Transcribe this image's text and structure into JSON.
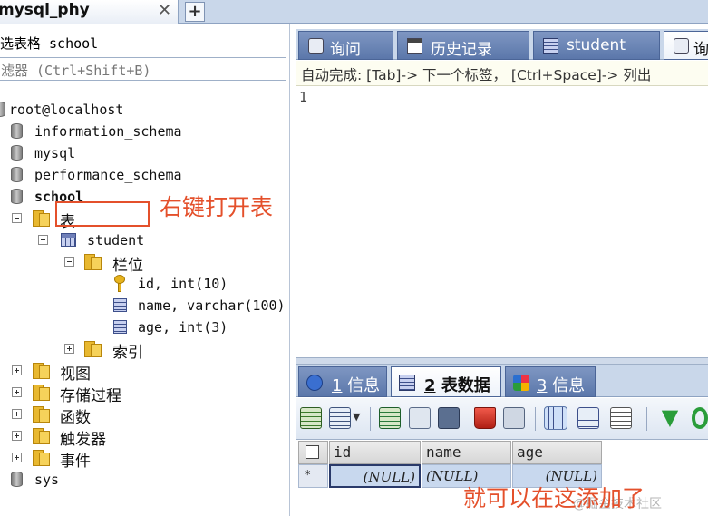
{
  "connection_tab": {
    "label": "mysql_phy",
    "close_glyph": "✕",
    "new_tab_glyph": "+"
  },
  "object_browser": {
    "db_selector": "选表格 school",
    "filter_placeholder": "滤器 (Ctrl+Shift+B)",
    "tree": {
      "root": "root@localhost",
      "databases": [
        "information_schema",
        "mysql",
        "performance_schema",
        "school"
      ],
      "school_children": {
        "tables_folder": "表",
        "table": "student",
        "columns_folder": "栏位",
        "columns": [
          "id, int(10)",
          "name, varchar(100)",
          "age, int(3)"
        ],
        "indexes_folder": "索引",
        "other_folders": [
          "视图",
          "存储过程",
          "函数",
          "触发器",
          "事件"
        ]
      },
      "last_db": "sys"
    }
  },
  "annotations": {
    "open_table": "右键打开表",
    "add_here": "就可以在这添加了"
  },
  "query_tabs": {
    "items": [
      {
        "label": "询问",
        "icon": "query-icon"
      },
      {
        "label": "历史记录",
        "icon": "history-icon"
      },
      {
        "label": "student",
        "icon": "table-icon"
      },
      {
        "label": "询",
        "icon": "query-icon"
      }
    ],
    "autocomplete_hint": "自动完成:  [Tab]-> 下一个标签，  [Ctrl+Space]-> 列出",
    "line_number": "1"
  },
  "result_tabs": {
    "items": [
      {
        "num": "1",
        "label": "信息",
        "icon": "info-icon"
      },
      {
        "num": "2",
        "label": "表数据",
        "icon": "table-data-icon"
      },
      {
        "num": "3",
        "label": "信息",
        "icon": "multi-info-icon"
      }
    ]
  },
  "grid": {
    "columns": [
      "id",
      "name",
      "age"
    ],
    "row_marker": "*",
    "row": [
      "(NULL)",
      "(NULL)",
      "(NULL)"
    ]
  },
  "watermark": "@掘金技术社区"
}
